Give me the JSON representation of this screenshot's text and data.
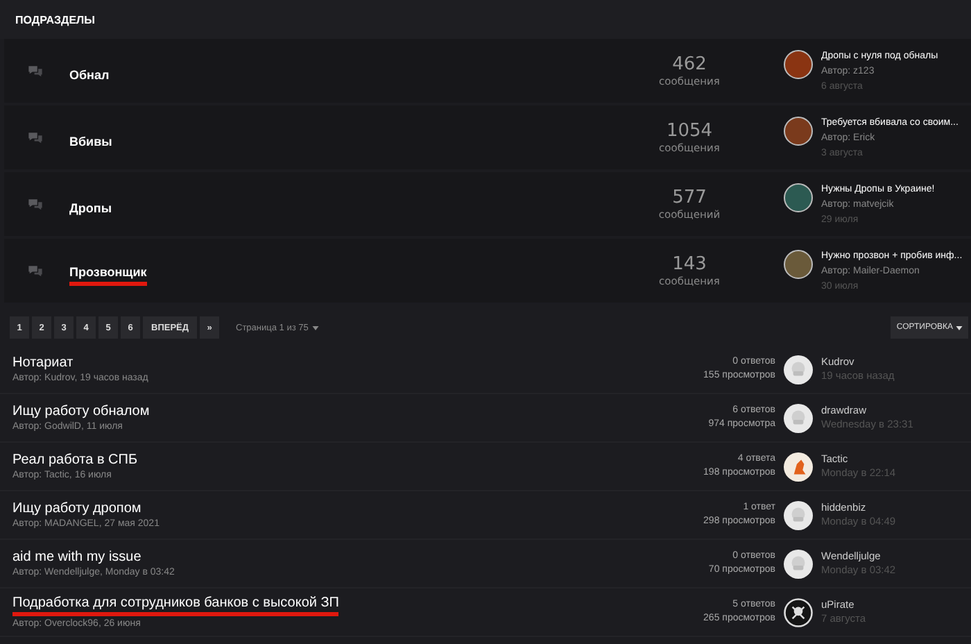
{
  "section": {
    "title": "ПОДРАЗДЕЛЫ"
  },
  "forums": [
    {
      "name": "Обнал",
      "highlighted": false,
      "count": "462",
      "count_label": "сообщения",
      "last_title": "Дропы с нуля под обналы",
      "last_author": "Автор: z123",
      "last_date": "6 августа",
      "color": "#8a3412"
    },
    {
      "name": "Вбивы",
      "highlighted": false,
      "count": "1054",
      "count_label": "сообщения",
      "last_title": "Требуется вбивала со своим...",
      "last_author": "Автор: Erick",
      "last_date": "3 августа",
      "color": "#7a3a1c"
    },
    {
      "name": "Дропы",
      "highlighted": false,
      "count": "577",
      "count_label": "сообщений",
      "last_title": "Нужны Дропы в Украине!",
      "last_author": "Автор: matvejcik",
      "last_date": "29 июля",
      "color": "#2c5a52"
    },
    {
      "name": "Прозвонщик",
      "highlighted": true,
      "count": "143",
      "count_label": "сообщения",
      "last_title": "Нужно прозвон + пробив инф...",
      "last_author": "Автор: Mailer-Daemon",
      "last_date": "30 июля",
      "color": "#6a5a3a"
    }
  ],
  "pagination": {
    "pages": [
      "1",
      "2",
      "3",
      "4",
      "5",
      "6"
    ],
    "next": "ВПЕРЁД",
    "last": "»",
    "page_info": "Страница 1 из 75",
    "sort": "СОРТИРОВКА"
  },
  "topics": [
    {
      "title": "Нотариат",
      "highlighted": false,
      "meta": "Автор: Kudrov, 19 часов назад",
      "replies": "0 ответов",
      "views": "155 просмотров",
      "kind": "default",
      "last_user": "Kudrov",
      "last_time": "19 часов назад"
    },
    {
      "title": "Ищу работу обналом",
      "highlighted": false,
      "meta": "Автор: GodwilD, 11 июля",
      "replies": "6 ответов",
      "views": "974 просмотра",
      "kind": "default",
      "last_user": "drawdraw",
      "last_time": "Wednesday в 23:31"
    },
    {
      "title": "Реал работа в СПБ",
      "highlighted": false,
      "meta": "Автор: Tactic, 16 июля",
      "replies": "4 ответа",
      "views": "198 просмотров",
      "kind": "picture",
      "last_user": "Tactic",
      "last_time": "Monday в 22:14"
    },
    {
      "title": "Ищу работу дропом",
      "highlighted": false,
      "meta": "Автор: MADANGEL, 27 мая 2021",
      "replies": "1 ответ",
      "views": "298 просмотров",
      "kind": "default",
      "last_user": "hiddenbiz",
      "last_time": "Monday в 04:49"
    },
    {
      "title": "aid me with my issue",
      "highlighted": false,
      "meta": "Автор: Wendelljulge, Monday в 03:42",
      "replies": "0 ответов",
      "views": "70 просмотров",
      "kind": "default",
      "last_user": "Wendelljulge",
      "last_time": "Monday в 03:42"
    },
    {
      "title": "Подработка для сотрудников банков с высокой ЗП",
      "highlighted": true,
      "meta": "Автор: Overclock96, 26 июня",
      "replies": "5 ответов",
      "views": "265 просмотров",
      "kind": "emblem",
      "last_user": "uPirate",
      "last_time": "7 августа"
    }
  ]
}
